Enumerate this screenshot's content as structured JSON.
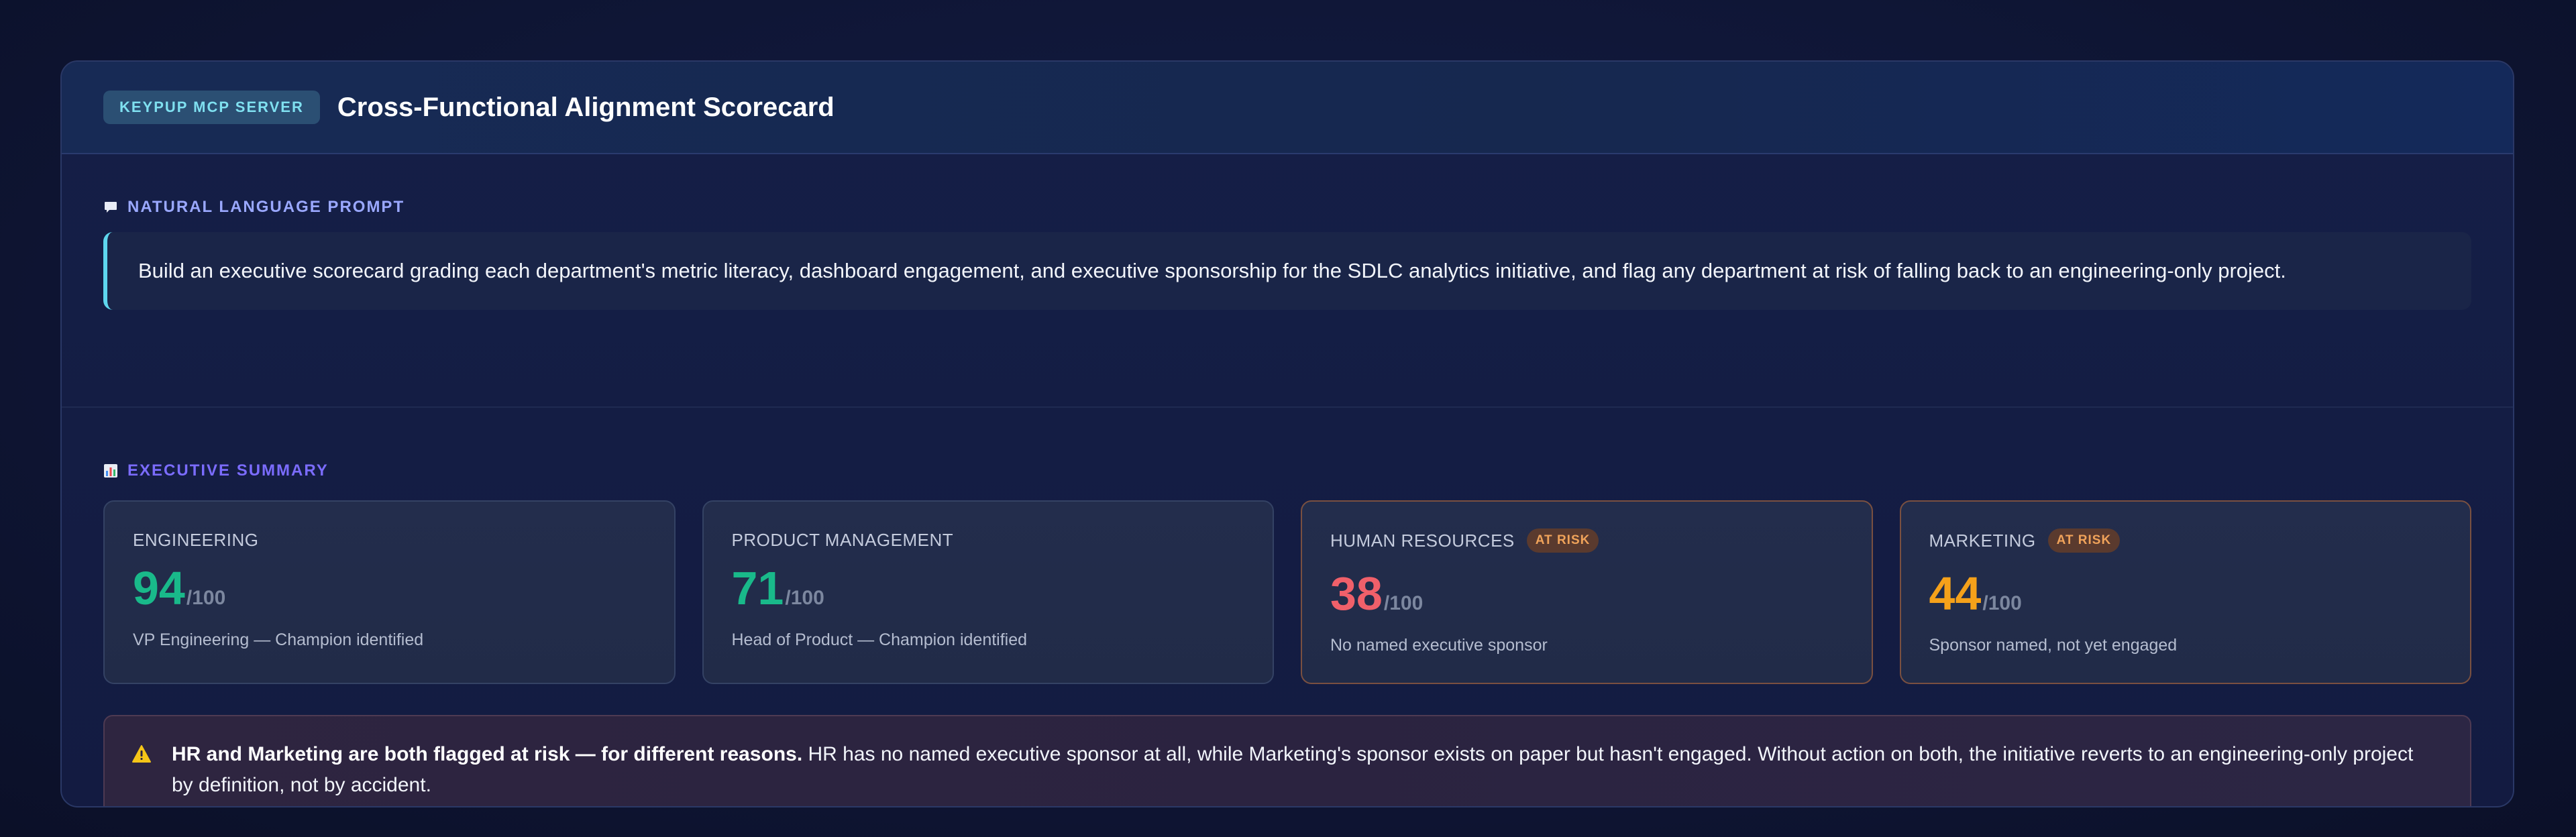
{
  "header": {
    "badge": "KEYPUP MCP SERVER",
    "title": "Cross-Functional Alignment Scorecard"
  },
  "prompt": {
    "label": "NATURAL LANGUAGE PROMPT",
    "icon": "speech-bubble-icon",
    "text": "Build an executive scorecard grading each department's metric literacy, dashboard engagement, and executive sponsorship for the SDLC analytics initiative, and flag any department at risk of falling back to an engineering-only project."
  },
  "summary": {
    "label": "EXECUTIVE SUMMARY",
    "icon": "bar-chart-icon",
    "cards": [
      {
        "department": "ENGINEERING",
        "score": "94",
        "out_of": "/100",
        "subtitle": "VP Engineering — Champion identified",
        "at_risk": false,
        "badge": "",
        "color": "#19b98a"
      },
      {
        "department": "PRODUCT MANAGEMENT",
        "score": "71",
        "out_of": "/100",
        "subtitle": "Head of Product — Champion identified",
        "at_risk": false,
        "badge": "",
        "color": "#19b98a"
      },
      {
        "department": "HUMAN RESOURCES",
        "score": "38",
        "out_of": "/100",
        "subtitle": "No named executive sponsor",
        "at_risk": true,
        "badge": "AT RISK",
        "color": "#f0606a"
      },
      {
        "department": "MARKETING",
        "score": "44",
        "out_of": "/100",
        "subtitle": "Sponsor named, not yet engaged",
        "at_risk": true,
        "badge": "AT RISK",
        "color": "#f5a11a"
      }
    ]
  },
  "alert": {
    "icon": "warning-icon",
    "bold": "HR and Marketing are both flagged at risk — for different reasons.",
    "text": " HR has no named executive sponsor at all, while Marketing's sponsor exists on paper but hasn't engaged. Without action on both, the initiative reverts to an engineering-only project by definition, not by accident."
  }
}
